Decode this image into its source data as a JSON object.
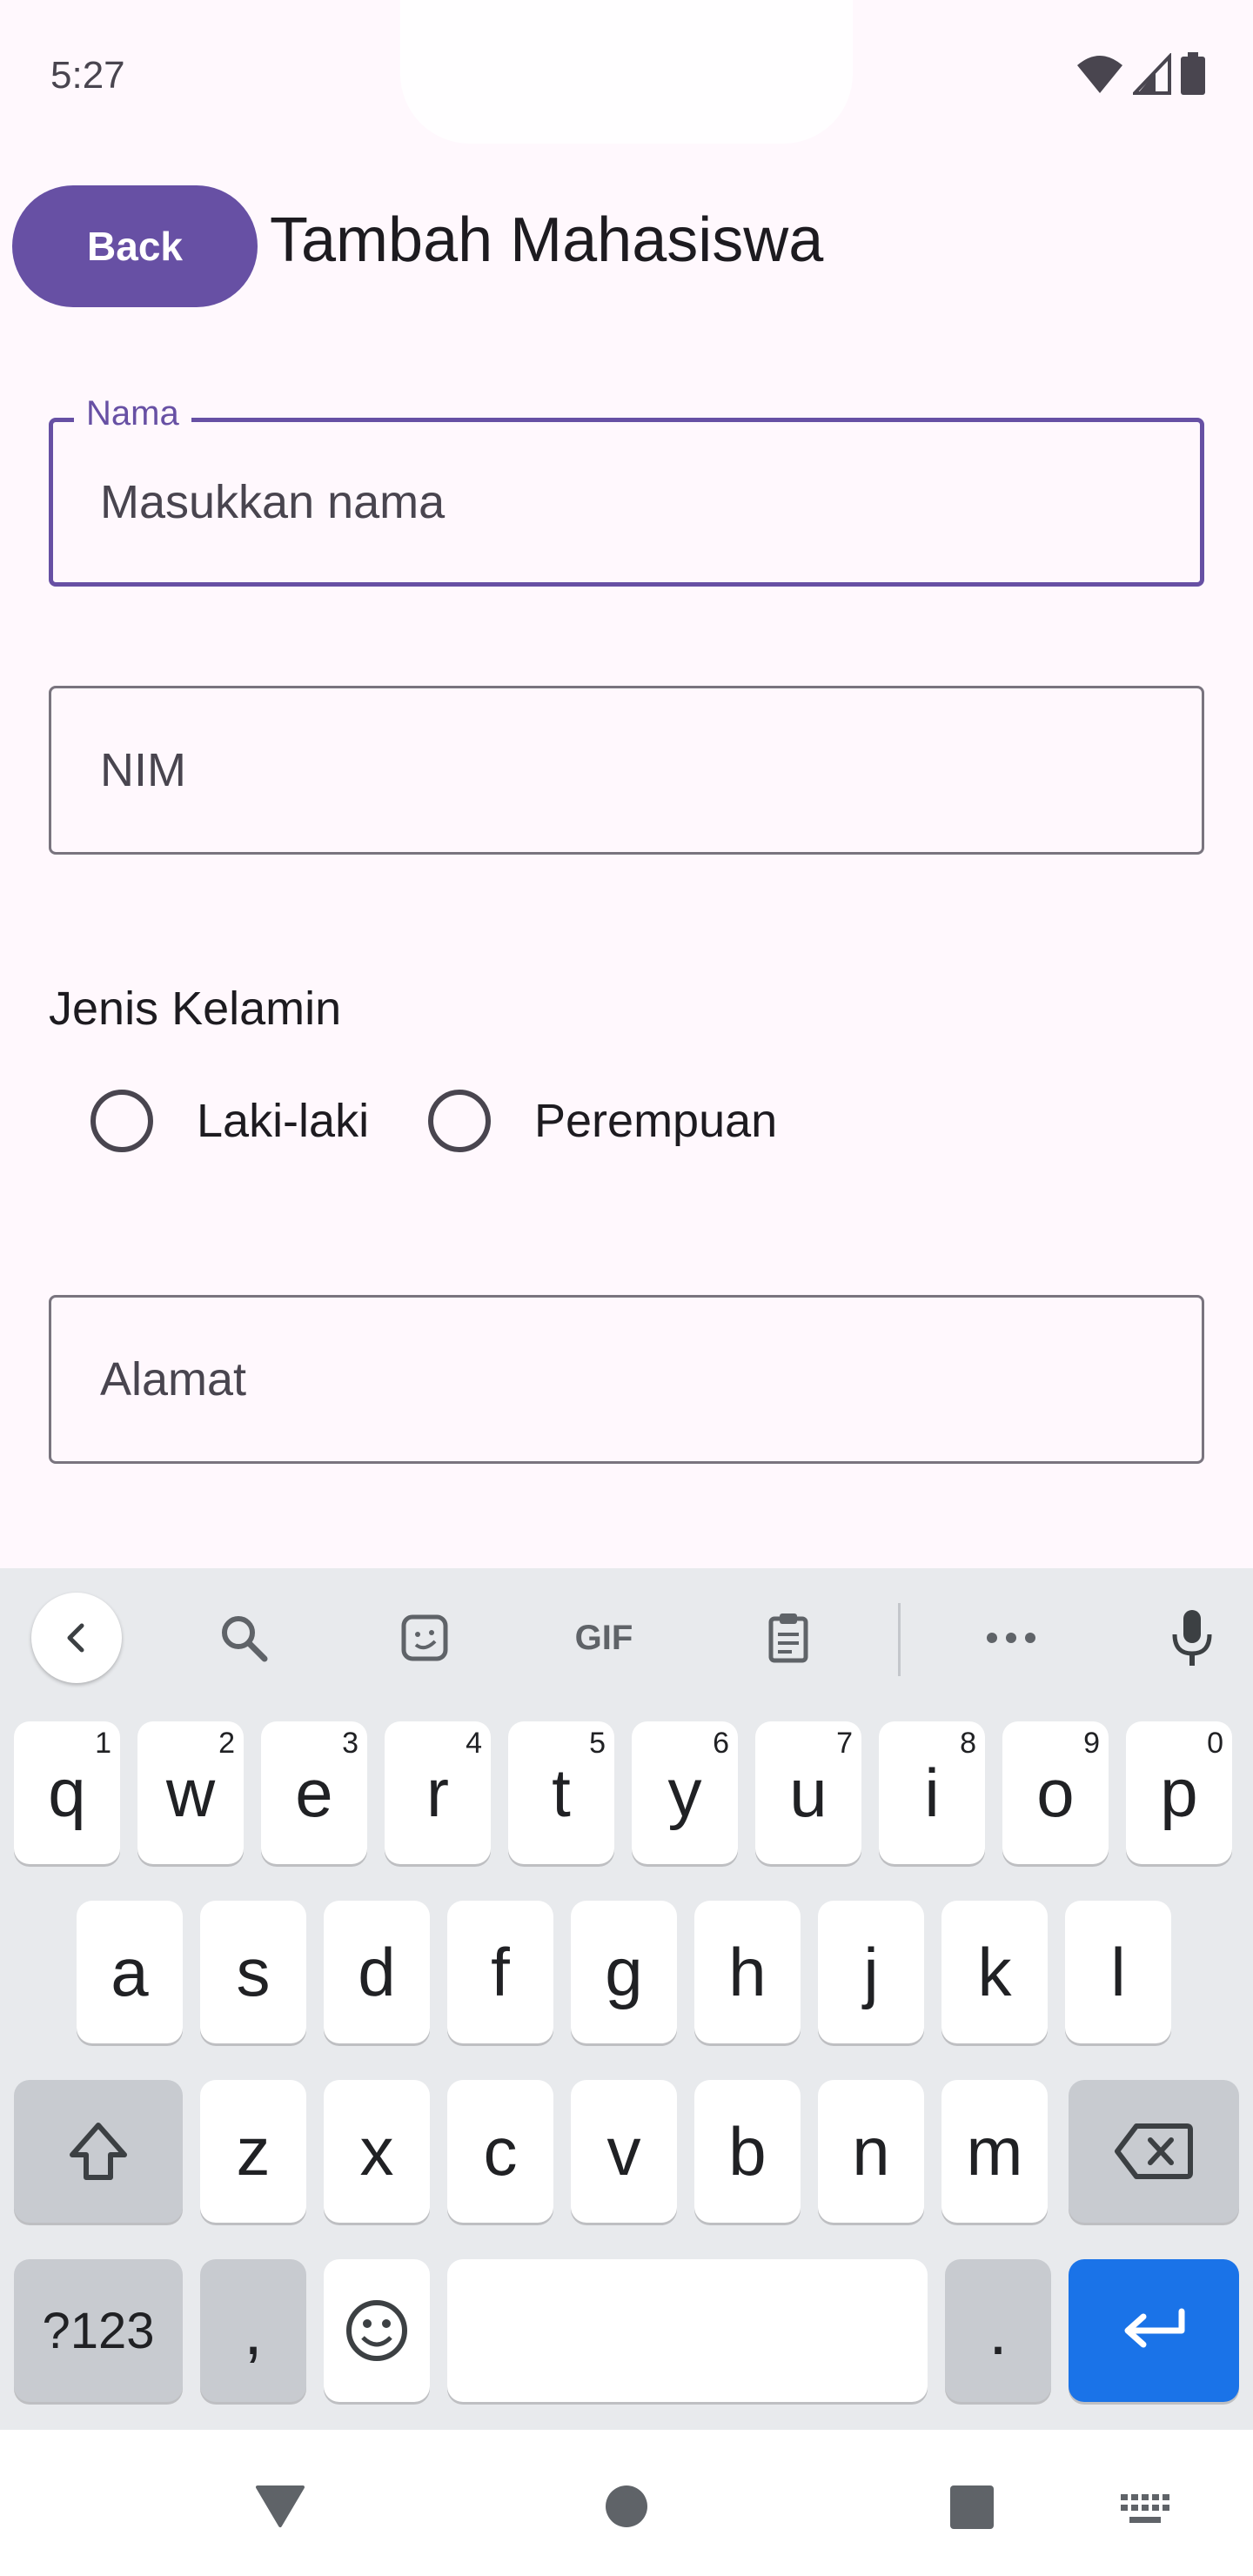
{
  "status_bar": {
    "time": "5:27"
  },
  "header": {
    "back_label": "Back",
    "title": "Tambah Mahasiswa"
  },
  "form": {
    "nama": {
      "label": "Nama",
      "placeholder": "Masukkan nama"
    },
    "nim": {
      "placeholder": "NIM"
    },
    "jenis_kelamin": {
      "label": "Jenis Kelamin",
      "options": [
        {
          "label": "Laki-laki",
          "selected": false
        },
        {
          "label": "Perempuan",
          "selected": false
        }
      ]
    },
    "alamat": {
      "placeholder": "Alamat"
    }
  },
  "keyboard": {
    "toolbar": [
      "collapse-icon",
      "search-icon",
      "sticker-icon",
      "GIF",
      "clipboard-icon",
      "more-icon",
      "mic-icon"
    ],
    "row1": [
      {
        "key": "q",
        "hint": "1"
      },
      {
        "key": "w",
        "hint": "2"
      },
      {
        "key": "e",
        "hint": "3"
      },
      {
        "key": "r",
        "hint": "4"
      },
      {
        "key": "t",
        "hint": "5"
      },
      {
        "key": "y",
        "hint": "6"
      },
      {
        "key": "u",
        "hint": "7"
      },
      {
        "key": "i",
        "hint": "8"
      },
      {
        "key": "o",
        "hint": "9"
      },
      {
        "key": "p",
        "hint": "0"
      }
    ],
    "row2": [
      "a",
      "s",
      "d",
      "f",
      "g",
      "h",
      "j",
      "k",
      "l"
    ],
    "row3": [
      "z",
      "x",
      "c",
      "v",
      "b",
      "n",
      "m"
    ],
    "symbols_label": "?123",
    "comma": ",",
    "period": ".",
    "accent_color": "#1A73E8"
  }
}
